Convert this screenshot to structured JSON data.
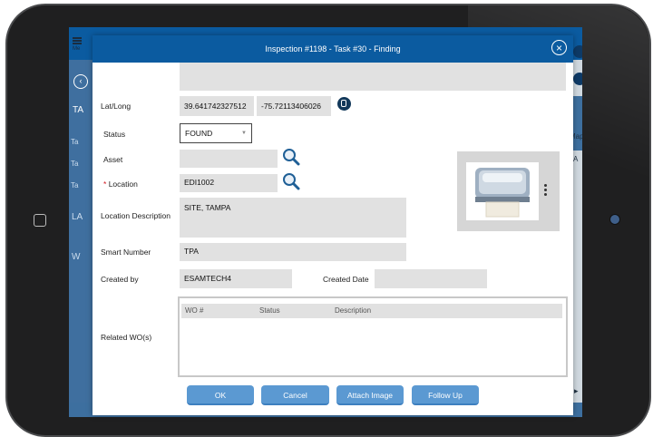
{
  "background": {
    "menu_label": "Me",
    "left_cells": [
      "TA",
      "Ta",
      "Ta",
      "Ta",
      "LA",
      "W"
    ],
    "right_cells": [
      "Map",
      "A"
    ]
  },
  "dialog": {
    "title": "Inspection #1198 - Task #30 - Finding",
    "fields": {
      "latlong": {
        "label": "Lat/Long",
        "lat": "39.641742327512",
        "long": "-75.72113406026"
      },
      "status": {
        "label": "Status",
        "value": "FOUND"
      },
      "asset": {
        "label": "Asset",
        "value": ""
      },
      "location": {
        "label": "Location",
        "required_mark": "*",
        "value": "EDI1002"
      },
      "location_description": {
        "label": "Location Description",
        "value": "SITE, TAMPA"
      },
      "smart_number": {
        "label": "Smart Number",
        "value": "TPA"
      },
      "created_by": {
        "label": "Created by",
        "value": "ESAMTECH4"
      },
      "created_date": {
        "label": "Created Date",
        "value": ""
      },
      "related_wo": {
        "label": "Related WO(s)"
      }
    },
    "wo_table": {
      "columns": [
        "WO #",
        "Status",
        "Description"
      ]
    },
    "buttons": {
      "ok": "OK",
      "cancel": "Cancel",
      "attach_image": "Attach Image",
      "follow_up": "Follow Up"
    }
  },
  "icons": {
    "close": "close-icon",
    "search": "search-icon",
    "map": "map-icon",
    "more": "more-vertical-icon"
  },
  "colors": {
    "header": "#0b5ba0",
    "button": "#5b99d2",
    "field": "#e1e1e1",
    "required": "#d2161e"
  }
}
